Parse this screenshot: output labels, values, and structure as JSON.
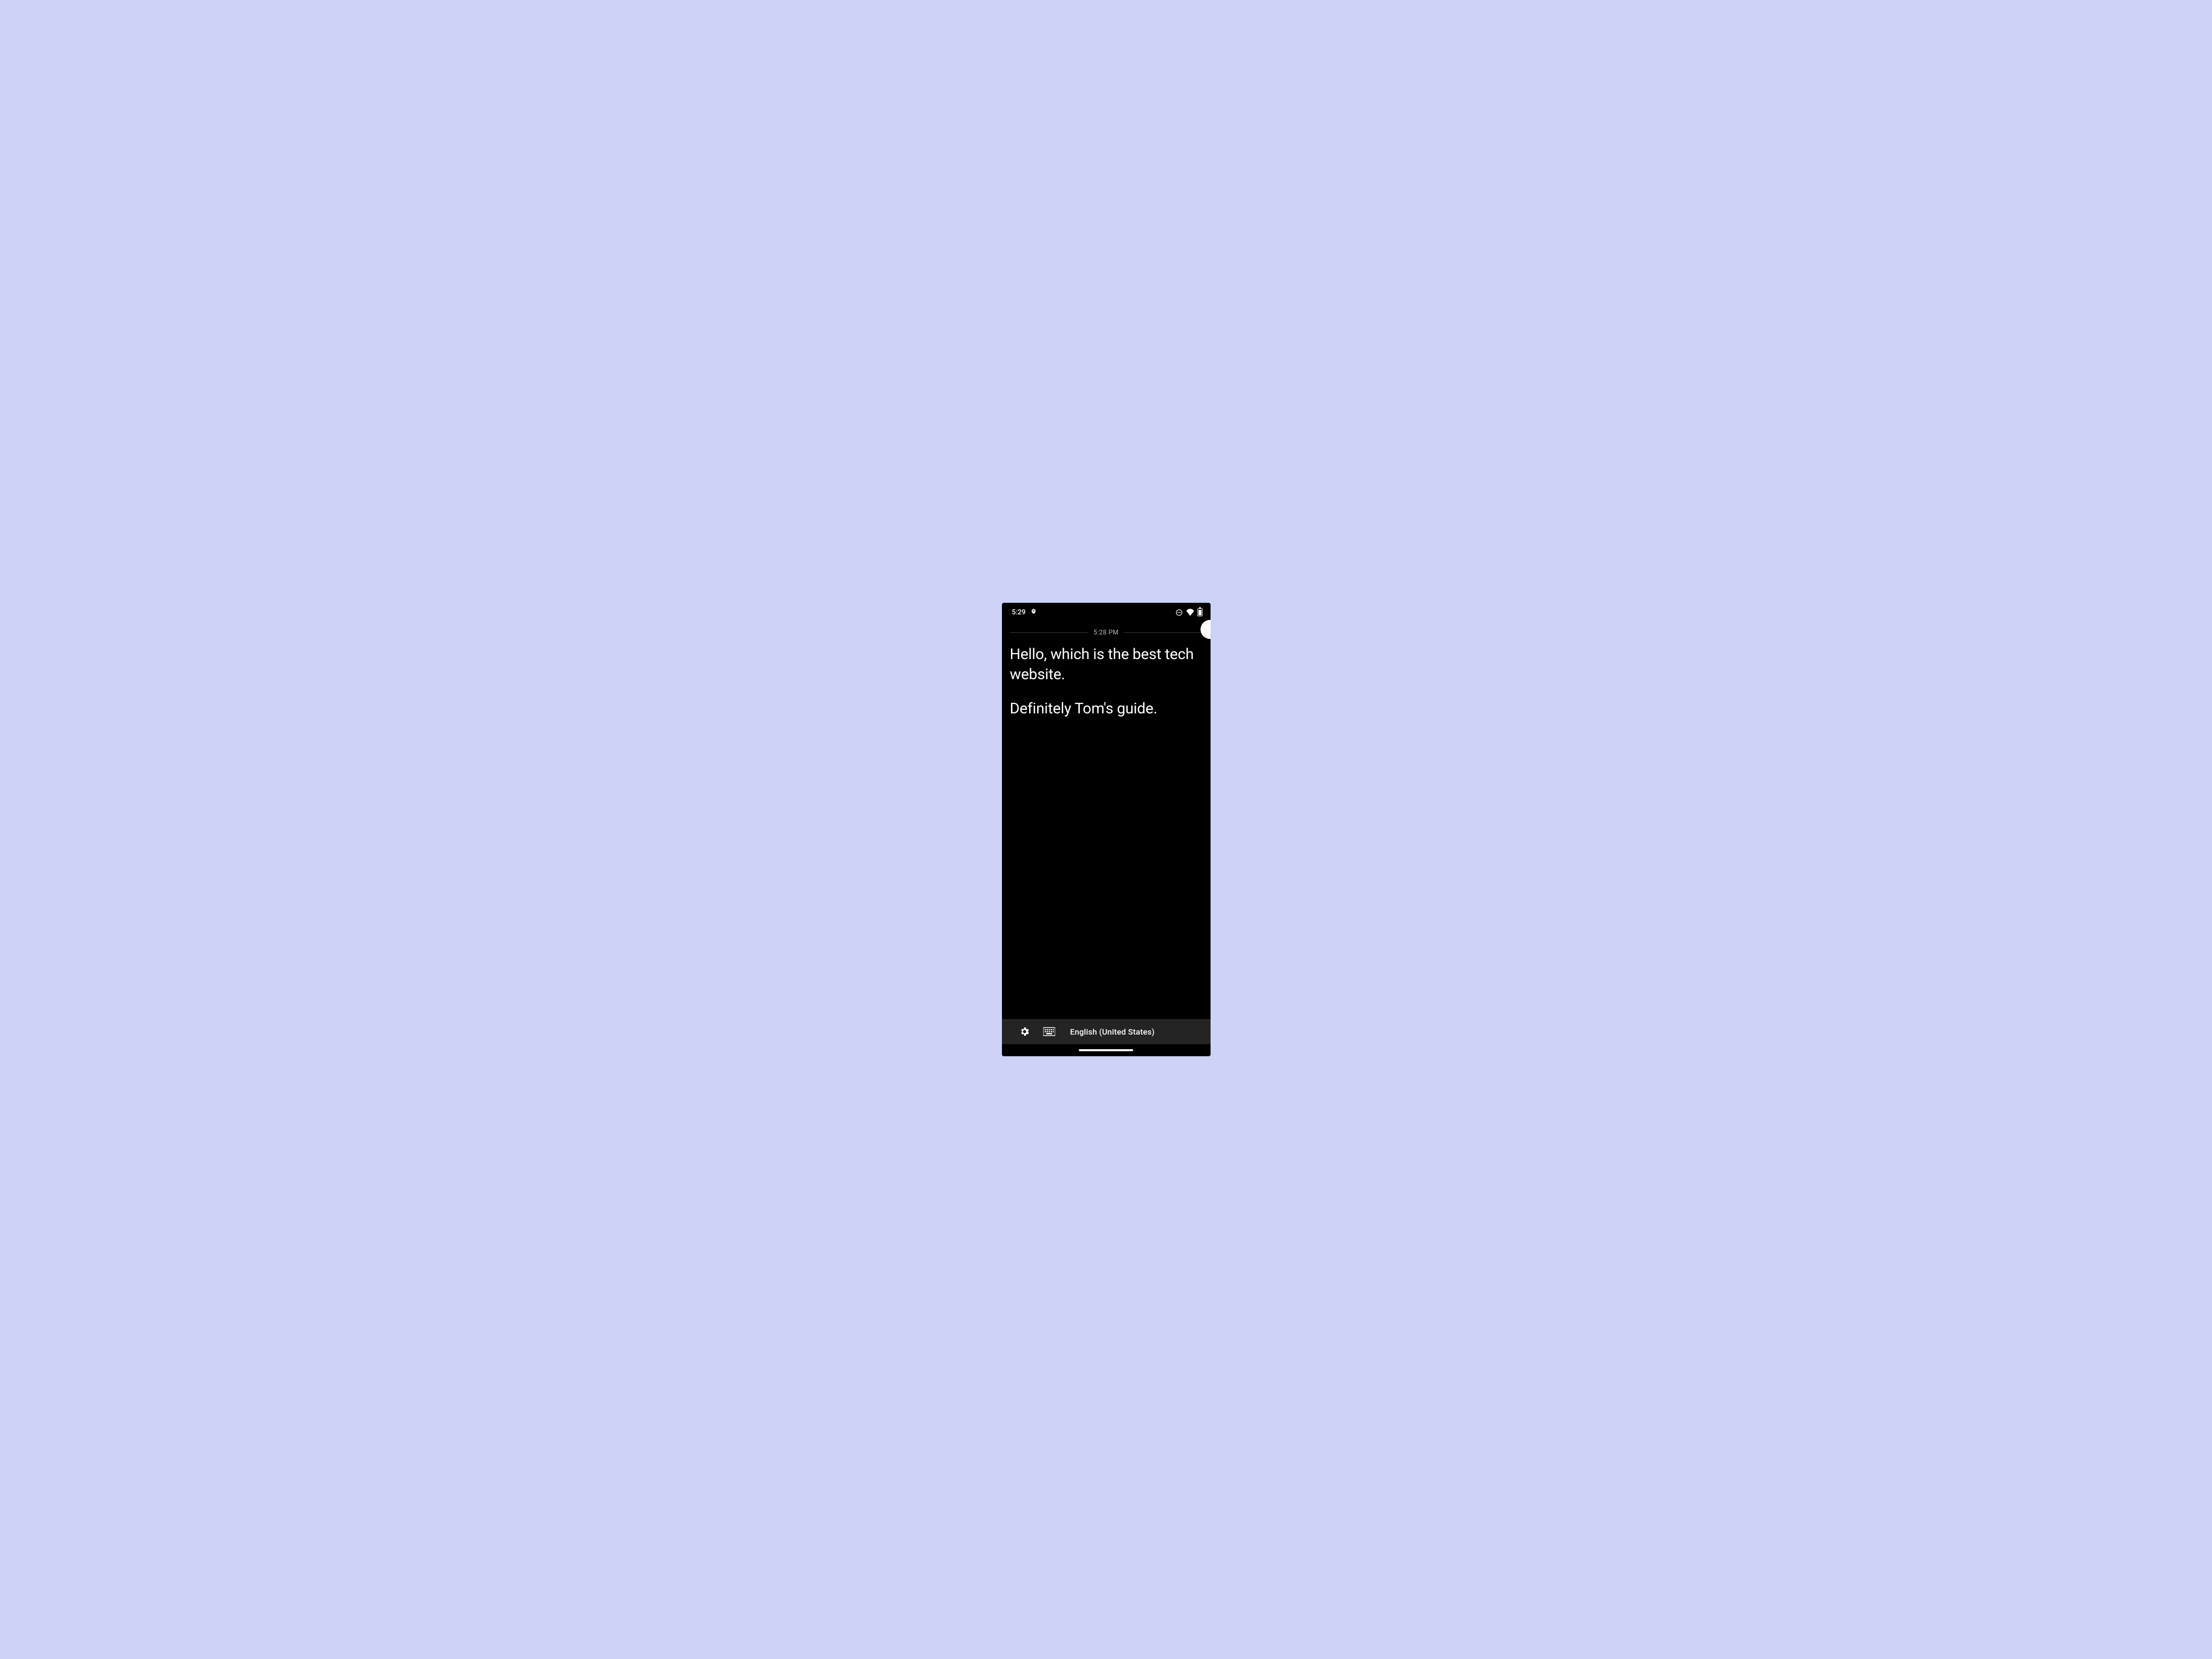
{
  "statusBar": {
    "time": "5:29"
  },
  "content": {
    "timestamp": "5:28 PM",
    "lines": [
      "Hello, which is the best tech website.",
      "Definitely Tom's guide."
    ]
  },
  "bottomBar": {
    "language": "English (United States)"
  }
}
